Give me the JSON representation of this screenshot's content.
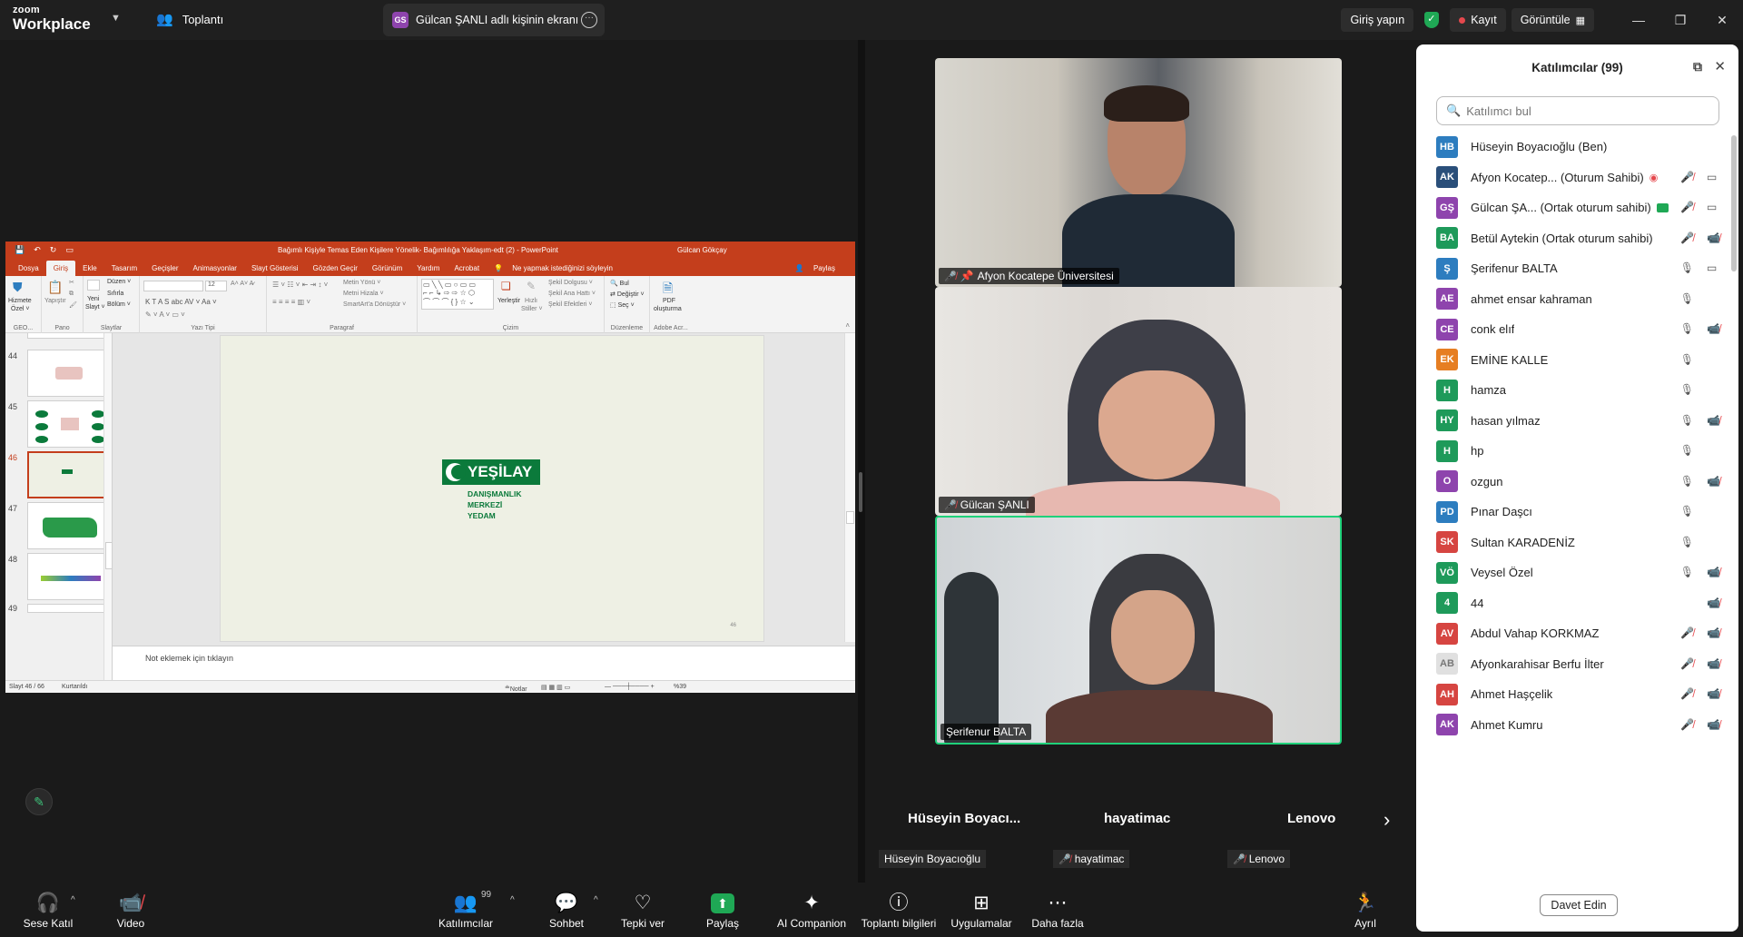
{
  "titlebar": {
    "logo_top": "zoom",
    "logo_bottom": "Workplace",
    "meeting_label": "Toplantı",
    "share_tab_badge": "GS",
    "share_tab_label": "Gülcan ŞANLI adlı kişinin ekranı",
    "sign_in": "Giriş yapın",
    "record": "Kayıt",
    "view": "Görüntüle"
  },
  "ppt": {
    "window_title": "Bağımlı Kişiyle Temas Eden Kişilere Yönelik- Bağımlılığa Yaklaşım-edt (2)  -  PowerPoint",
    "user": "Gülcan Gökçay",
    "tabs": [
      "Dosya",
      "Giriş",
      "Ekle",
      "Tasarım",
      "Geçişler",
      "Animasyonlar",
      "Slayt Gösterisi",
      "Gözden Geçir",
      "Görünüm",
      "Yardım",
      "Acrobat"
    ],
    "tell_me": "Ne yapmak istediğinizi söyleyin",
    "share": "Paylaş",
    "ribbon": {
      "service_top": "Hizmete",
      "service_bottom": "Özel ˅",
      "paste": "Yapıştır",
      "new_slide_top": "Yeni",
      "new_slide_bottom": "Slayt ˅",
      "layout": "Düzen ˅",
      "reset": "Sıfırla",
      "section": "Bölüm ˅",
      "font_size": "12",
      "text_dir": "Metin Yönü ˅",
      "align_text": "Metni Hizala ˅",
      "smartart": "SmartArt'a Dönüştür ˅",
      "arrange_top": "Yerleştir",
      "quick_top": "Hızlı",
      "quick_bottom": "Stiller ˅",
      "shape_fill": "Şekil Dolgusu ˅",
      "shape_outline": "Şekil Ana Hattı ˅",
      "shape_effects": "Şekil Efektleri ˅",
      "find": "Bul",
      "replace": "Değiştir ˅",
      "select": "Seç ˅",
      "pdf_top": "PDF",
      "pdf_bottom": "oluşturma",
      "group_geo": "GEO...",
      "group_pano": "Pano",
      "group_slides": "Slaytlar",
      "group_font": "Yazı Tipi",
      "group_para": "Paragraf",
      "group_draw": "Çizim",
      "group_edit": "Düzenleme",
      "group_adobe": "Adobe Acr..."
    },
    "thumb_numbers": [
      "44",
      "45",
      "46",
      "47",
      "48",
      "49"
    ],
    "slide_logo": "YEŞİLAY",
    "slide_sub": [
      "DANIŞMANLIK",
      "MERKEZİ",
      "YEDAM"
    ],
    "slide_number": "46",
    "notes_placeholder": "Not eklemek için tıklayın",
    "status_slide": "Slayt 46 / 66",
    "status_recovered": "Kurtarıldı",
    "status_notes": "Notlar",
    "zoom_level": "%39"
  },
  "videos": [
    {
      "name": "Afyon Kocatepe Üniversitesi",
      "muted": true,
      "pinned": true
    },
    {
      "name": "Gülcan ŞANLI",
      "muted": true,
      "pinned": false
    },
    {
      "name": "Şerifenur BALTA",
      "muted": false,
      "pinned": false
    }
  ],
  "gallery": {
    "names": [
      "Hüseyin  Boyacı...",
      "hayatimac",
      "Lenovo"
    ],
    "chips": [
      "Hüseyin Boyacıoğlu",
      "hayatimac",
      "Lenovo"
    ]
  },
  "panel": {
    "title": "Katılımcılar (99)",
    "search_placeholder": "Katılımcı bul",
    "participants": [
      {
        "initials": "HB",
        "name": "Hüseyin Boyacıoğlu (Ben)",
        "color": "#2d7dbf",
        "mic": "",
        "cam": ""
      },
      {
        "initials": "AK",
        "name": "Afyon Kocatep...  (Oturum Sahibi)",
        "color": "#2a4f7a",
        "mic": "off",
        "cam": "on",
        "rec": true
      },
      {
        "initials": "GŞ",
        "name": "Gülcan ŞA... (Ortak oturum sahibi)",
        "color": "#8e44ad",
        "mic": "off",
        "cam": "on",
        "share": true
      },
      {
        "initials": "BA",
        "name": "Betül Aytekin (Ortak oturum sahibi)",
        "color": "#1e9a5a",
        "mic": "off",
        "cam": "off"
      },
      {
        "initials": "Ş",
        "name": "Şerifenur BALTA",
        "color": "#2d7dbf",
        "mic": "on",
        "cam": "on"
      },
      {
        "initials": "AE",
        "name": "ahmet ensar kahraman",
        "color": "#8e44ad",
        "mic": "on",
        "cam": ""
      },
      {
        "initials": "CE",
        "name": "conk elıf",
        "color": "#8e44ad",
        "mic": "on",
        "cam": "off"
      },
      {
        "initials": "EK",
        "name": "EMİNE KALLE",
        "color": "#e67e22",
        "mic": "on",
        "cam": ""
      },
      {
        "initials": "H",
        "name": "hamza",
        "color": "#1e9a5a",
        "mic": "on",
        "cam": ""
      },
      {
        "initials": "HY",
        "name": "hasan yılmaz",
        "color": "#1e9a5a",
        "mic": "on",
        "cam": "off"
      },
      {
        "initials": "H",
        "name": "hp",
        "color": "#1e9a5a",
        "mic": "on",
        "cam": ""
      },
      {
        "initials": "O",
        "name": "ozgun",
        "color": "#8e44ad",
        "mic": "on",
        "cam": "off"
      },
      {
        "initials": "PD",
        "name": "Pınar Daşcı",
        "color": "#2d7dbf",
        "mic": "on",
        "cam": ""
      },
      {
        "initials": "SK",
        "name": "Sultan KARADENİZ",
        "color": "#d64541",
        "mic": "on",
        "cam": ""
      },
      {
        "initials": "VÖ",
        "name": "Veysel Özel",
        "color": "#1e9a5a",
        "mic": "on",
        "cam": "off"
      },
      {
        "initials": "4",
        "name": "44",
        "color": "#1e9a5a",
        "mic": "",
        "cam": "off"
      },
      {
        "initials": "AV",
        "name": "Abdul Vahap KORKMAZ",
        "color": "#d64541",
        "mic": "off",
        "cam": "off"
      },
      {
        "initials": "AB",
        "name": "Afyonkarahisar Berfu İlter",
        "color": "#e0e0e0",
        "mic": "off",
        "cam": "off"
      },
      {
        "initials": "AH",
        "name": "Ahmet Haşçelik",
        "color": "#d64541",
        "mic": "off",
        "cam": "off"
      },
      {
        "initials": "AK",
        "name": "Ahmet Kumru",
        "color": "#8e44ad",
        "mic": "off",
        "cam": "off"
      }
    ],
    "invite_label": "Davet Edin"
  },
  "toolbar": {
    "audio": "Sese Katıl",
    "video": "Video",
    "participants": "Katılımcılar",
    "participants_count": "99",
    "chat": "Sohbet",
    "react": "Tepki ver",
    "share": "Paylaş",
    "ai": "AI Companion",
    "info": "Toplantı bilgileri",
    "apps": "Uygulamalar",
    "more": "Daha fazla",
    "leave": "Ayrıl"
  },
  "colors": {
    "zoom_bg": "#1a1a1a",
    "ppt_red": "#c43e1c",
    "yesilay_green": "#0b7a3b",
    "active_speaker": "#1fd17a",
    "share_green": "#1fa855"
  }
}
